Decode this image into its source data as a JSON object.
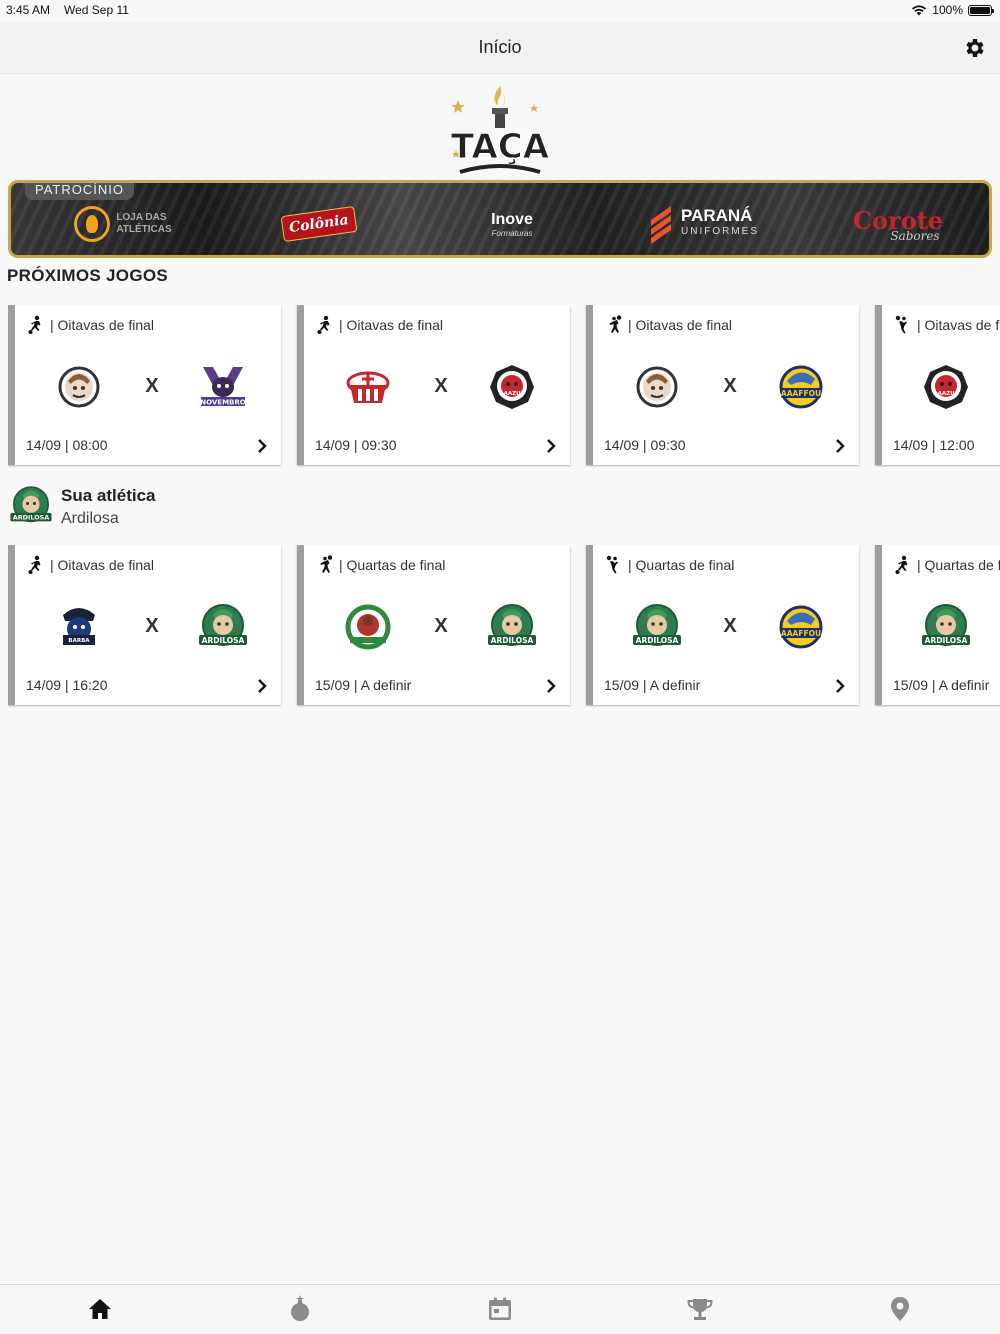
{
  "status_bar": {
    "time": "3:45 AM",
    "date": "Wed Sep 11",
    "battery": "100%"
  },
  "nav": {
    "title": "Início"
  },
  "brand": {
    "logo_text": "TAÇA"
  },
  "sponsors": {
    "label": "PATROCÍNIO",
    "items": [
      {
        "name": "Loja das Atléticas",
        "line1": "LOJA DAS",
        "line2": "ATLÉTICAS"
      },
      {
        "name": "Colônia",
        "text": "Colônia"
      },
      {
        "name": "Inove Formaturas",
        "text": "Inove",
        "sub": "Formaturas"
      },
      {
        "name": "Paraná Uniformes",
        "line1": "PARANÁ",
        "line2": "UNIFORMES"
      },
      {
        "name": "Corote Sabores",
        "text": "Corote",
        "sub": "Sabores"
      }
    ]
  },
  "proximos": {
    "title": "PRÓXIMOS JOGOS",
    "games": [
      {
        "sport_icon": "soccer-icon",
        "phase": "| Oitavas de final",
        "date": "14/09 | 08:00",
        "vs": "X"
      },
      {
        "sport_icon": "soccer-icon",
        "phase": "| Oitavas de final",
        "date": "14/09 | 09:30",
        "vs": "X"
      },
      {
        "sport_icon": "handball-icon",
        "phase": "| Oitavas de final",
        "date": "14/09 | 09:30",
        "vs": "X"
      },
      {
        "sport_icon": "volleyball-icon",
        "phase": "| Oitavas de final",
        "date": "14/09 | 12:00",
        "vs": "X"
      }
    ]
  },
  "sua_atletica": {
    "title": "Sua atlética",
    "name": "Ardilosa",
    "games": [
      {
        "sport_icon": "soccer-icon",
        "phase": "| Oitavas de final",
        "date": "14/09 | 16:20",
        "vs": "X"
      },
      {
        "sport_icon": "handball-icon",
        "phase": "| Quartas de final",
        "date": "15/09 | A definir",
        "vs": "X"
      },
      {
        "sport_icon": "volleyball-icon",
        "phase": "| Quartas de final",
        "date": "15/09 | A definir",
        "vs": "X"
      },
      {
        "sport_icon": "soccer-icon",
        "phase": "| Quartas de final",
        "date": "15/09 | A definir",
        "vs": "X"
      }
    ]
  },
  "tabs": [
    {
      "name": "home-icon"
    },
    {
      "name": "bomb-icon"
    },
    {
      "name": "calendar-icon"
    },
    {
      "name": "trophy-icon"
    },
    {
      "name": "location-pin-icon"
    }
  ],
  "colors": {
    "accent_gold": "#c9a64b",
    "card_border": "#9e9e9e",
    "ardilosa_green": "#2e7d4f",
    "aaaffou_yellow": "#f2cc1e",
    "brick_red": "#c8262b"
  }
}
